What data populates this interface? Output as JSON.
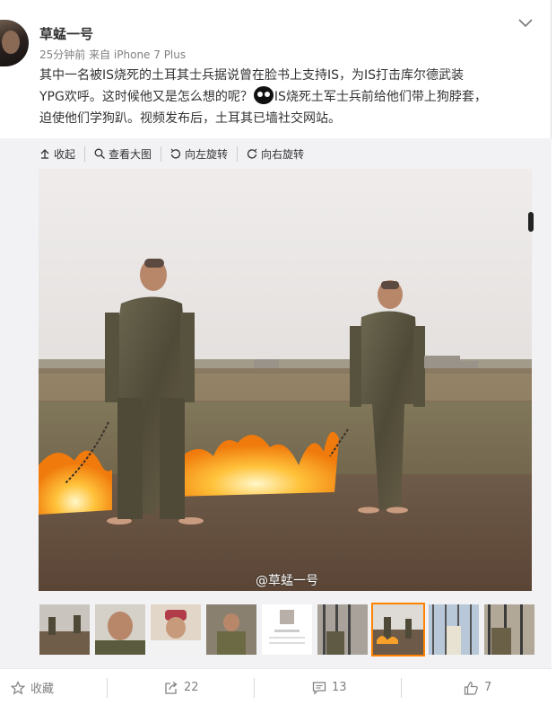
{
  "post": {
    "username": "草蜢一号",
    "time": "25分钟前",
    "source": "来自 iPhone 7 Plus",
    "line1": "其中一名被IS烧死的土耳其士兵据说曾在脸书上支持IS，为IS打击库尔德武装",
    "line2a": "YPG欢呼。这时候他又是怎么想的呢？",
    "line2b": "IS烧死土军士兵前给他们带上狗脖套，",
    "line3": "迫使他们学狗趴。视频发布后，土耳其已墙社交网站。"
  },
  "toolbar": {
    "collapse": "收起",
    "view_large": "查看大图",
    "rotate_left": "向左旋转",
    "rotate_right": "向右旋转"
  },
  "image": {
    "watermark": "@草蜢一号"
  },
  "footer": {
    "favorite": "收藏",
    "repost_count": "22",
    "comment_count": "13",
    "like_count": "7"
  },
  "colors": {
    "accent": "#ff8200",
    "text": "#333333",
    "muted": "#808080",
    "media_bg": "#f2f2f5"
  },
  "icons": [
    "chevron-down-icon",
    "collapse-up-icon",
    "zoom-icon",
    "rotate-left-icon",
    "rotate-right-icon",
    "star-icon",
    "repost-icon",
    "comment-icon",
    "like-icon"
  ]
}
